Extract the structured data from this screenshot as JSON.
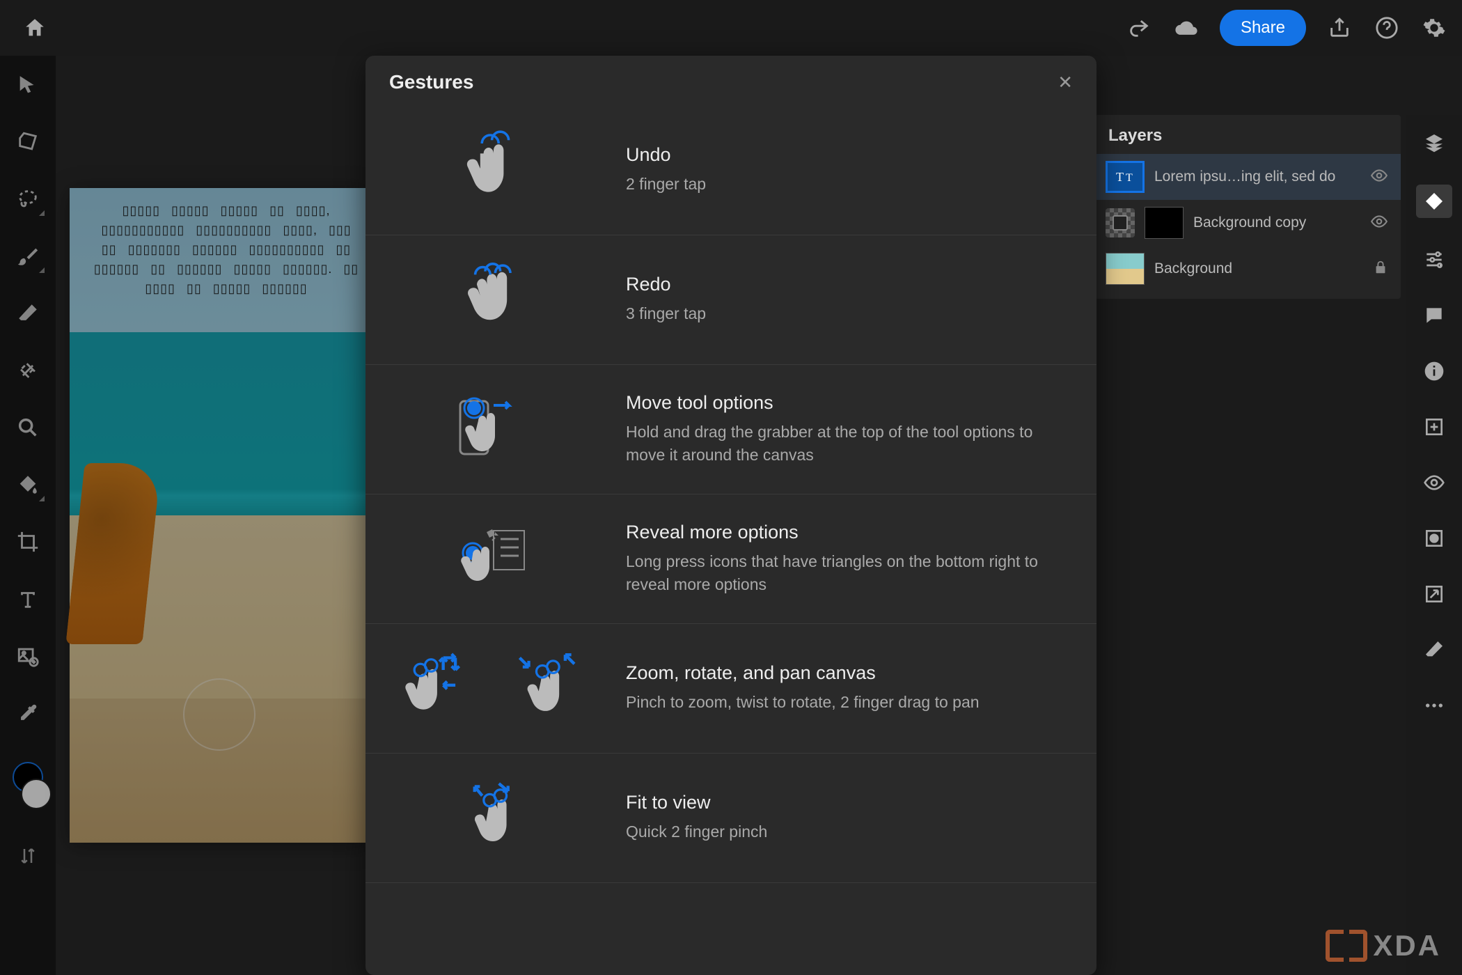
{
  "header": {
    "share_label": "Share"
  },
  "layers_panel": {
    "title": "Layers",
    "items": [
      {
        "name": "Lorem ipsu…ing elit, sed do",
        "type": "text",
        "visible": true,
        "selected": true
      },
      {
        "name": "Background copy",
        "type": "mask",
        "visible": true,
        "selected": false
      },
      {
        "name": "Background",
        "type": "image",
        "locked": true,
        "selected": false
      }
    ]
  },
  "modal": {
    "title": "Gestures",
    "gestures": [
      {
        "title": "Undo",
        "desc": "2 finger tap"
      },
      {
        "title": "Redo",
        "desc": "3 finger tap"
      },
      {
        "title": "Move tool options",
        "desc": "Hold and drag the grabber at the top of the tool options to move it around the canvas"
      },
      {
        "title": "Reveal more options",
        "desc": "Long press icons that have triangles on the bottom right to reveal more options"
      },
      {
        "title": "Zoom, rotate, and pan canvas",
        "desc": "Pinch to zoom, twist to rotate, 2 finger drag to pan"
      },
      {
        "title": "Fit to view",
        "desc": "Quick 2 finger pinch"
      }
    ]
  },
  "canvas": {
    "placeholder_glyphs": "▯▯▯▯▯ ▯▯▯▯▯ ▯▯▯▯▯ ▯▯ ▯▯▯▯, ▯▯▯▯▯▯▯▯▯▯▯ ▯▯▯▯▯▯▯▯▯▯ ▯▯▯▯, ▯▯▯ ▯▯ ▯▯▯▯▯▯▯ ▯▯▯▯▯▯ ▯▯▯▯▯▯▯▯▯▯ ▯▯ ▯▯▯▯▯▯ ▯▯ ▯▯▯▯▯▯ ▯▯▯▯▯ ▯▯▯▯▯▯. ▯▯ ▯▯▯▯ ▯▯ ▯▯▯▯▯ ▯▯▯▯▯▯"
  },
  "watermark": {
    "text": "XDA"
  }
}
